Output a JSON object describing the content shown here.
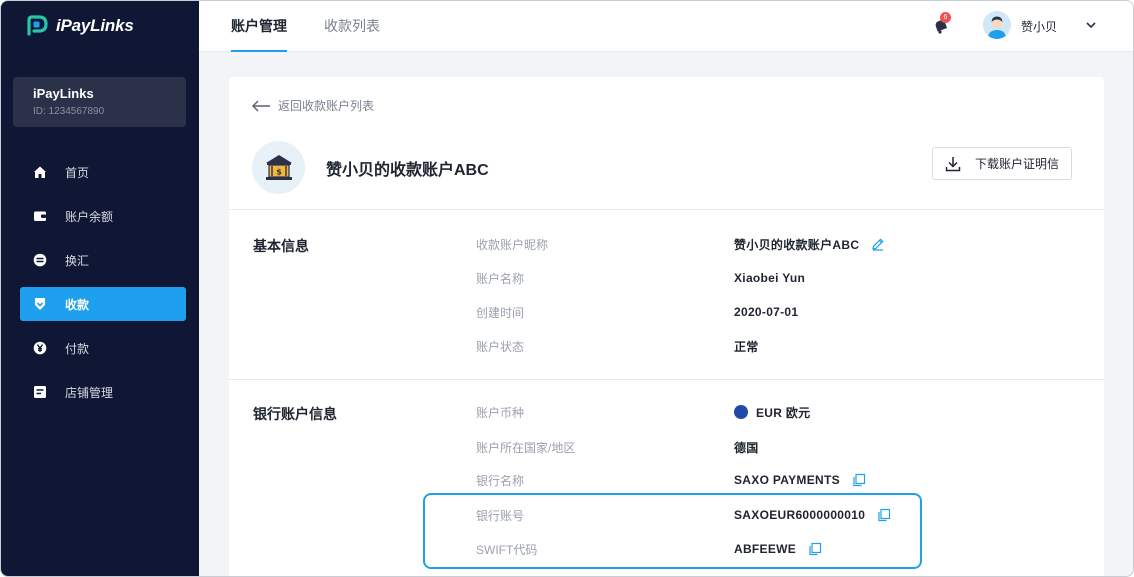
{
  "brand": {
    "name": "iPayLinks"
  },
  "account": {
    "name": "iPayLinks",
    "id": "ID: 1234567890"
  },
  "nav": [
    {
      "label": "首页",
      "icon": "home-icon"
    },
    {
      "label": "账户余额",
      "icon": "wallet-icon"
    },
    {
      "label": "换汇",
      "icon": "exchange-icon"
    },
    {
      "label": "收款",
      "icon": "receive-icon",
      "active": true
    },
    {
      "label": "付款",
      "icon": "yen-icon"
    },
    {
      "label": "店铺管理",
      "icon": "store-icon"
    }
  ],
  "tabs": {
    "account": "账户管理",
    "list": "收款列表"
  },
  "header": {
    "notifications": "6",
    "user_name": "赞小贝"
  },
  "back": "返回收款账户列表",
  "title": "赞小贝的收款账户ABC",
  "download_label": "下载账户证明信",
  "basic": {
    "title": "基本信息",
    "rows": [
      {
        "label": "收款账户昵称",
        "value": "赞小贝的收款账户ABC"
      },
      {
        "label": "账户名称",
        "value": "Xiaobei Yun"
      },
      {
        "label": "创建时间",
        "value": "2020-07-01"
      },
      {
        "label": "账户状态",
        "value": "正常"
      }
    ]
  },
  "bank": {
    "title": "银行账户信息",
    "rows": [
      {
        "label": "账户币种",
        "value": "EUR 欧元"
      },
      {
        "label": "账户所在国家/地区",
        "value": "德国"
      },
      {
        "label": "银行名称",
        "value": "SAXO PAYMENTS"
      },
      {
        "label": "银行账号",
        "value": "SAXOEUR6000000010"
      },
      {
        "label": "SWIFT代码",
        "value": "ABFEEWE"
      }
    ]
  },
  "colors": {
    "sidebar": "#0f1735",
    "accent": "#1ea0ee",
    "badge": "#f05050"
  }
}
